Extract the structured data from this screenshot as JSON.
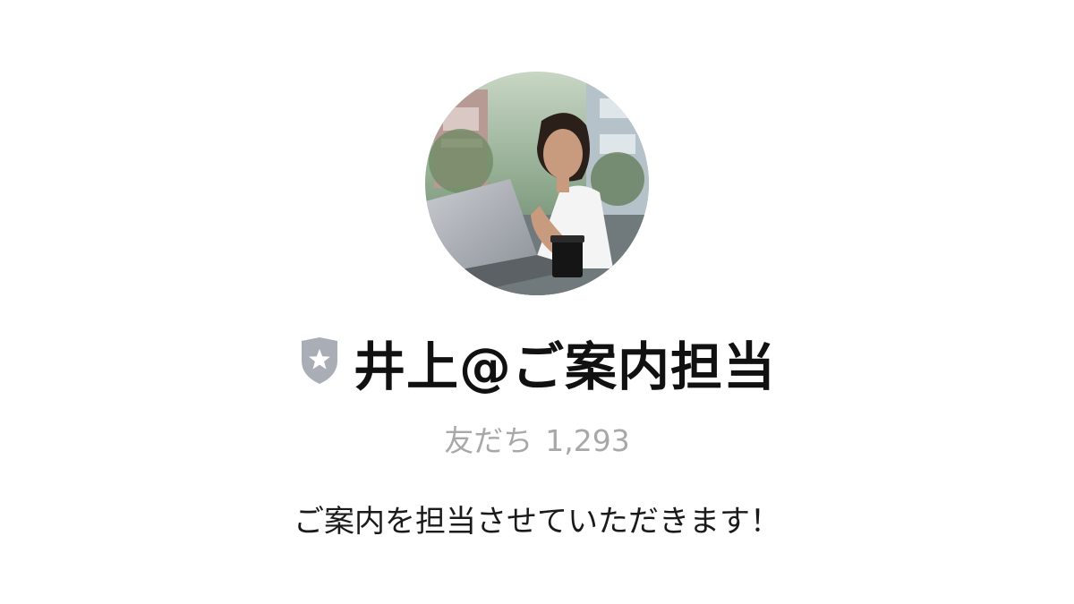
{
  "profile": {
    "avatar_icon": "profile-photo",
    "badge_icon": "shield-star-icon",
    "badge_color": "#a9adb6",
    "name": "井上@ご案内担当",
    "friends_label": "友だち",
    "friends_count": "1,293",
    "status_message": "ご案内を担当させていただきます！"
  }
}
